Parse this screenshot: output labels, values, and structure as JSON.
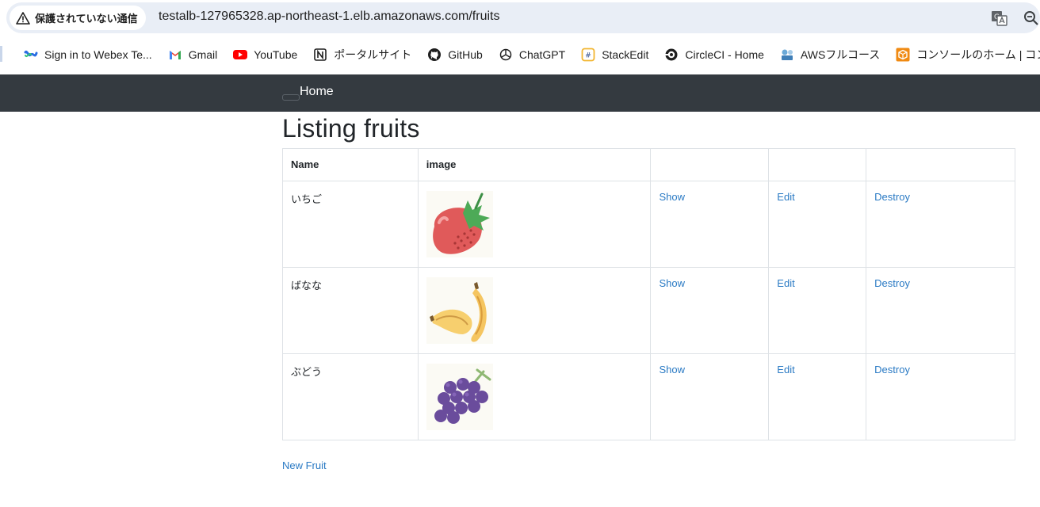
{
  "browser": {
    "security_label": "保護されていない通信",
    "url": "testalb-127965328.ap-northeast-1.elb.amazonaws.com/fruits"
  },
  "bookmarks": [
    {
      "label": "Sign in to Webex Te...",
      "icon": "webex-icon"
    },
    {
      "label": "Gmail",
      "icon": "gmail-icon"
    },
    {
      "label": "YouTube",
      "icon": "youtube-icon"
    },
    {
      "label": "ポータルサイト",
      "icon": "notion-icon"
    },
    {
      "label": "GitHub",
      "icon": "github-icon"
    },
    {
      "label": "ChatGPT",
      "icon": "chatgpt-icon"
    },
    {
      "label": "StackEdit",
      "icon": "stackedit-icon"
    },
    {
      "label": "CircleCI - Home",
      "icon": "circleci-icon"
    },
    {
      "label": "AWSフルコース",
      "icon": "aws-course-icon"
    },
    {
      "label": "コンソールのホーム | コン...",
      "icon": "aws-console-icon"
    }
  ],
  "navbar": {
    "home_label": "Home"
  },
  "page": {
    "title": "Listing fruits",
    "new_link": "New Fruit"
  },
  "table": {
    "headers": [
      "Name",
      "image",
      "",
      "",
      ""
    ],
    "rows": [
      {
        "name": "いちご",
        "image": "strawberry-image",
        "show": "Show",
        "edit": "Edit",
        "destroy": "Destroy"
      },
      {
        "name": "ばなな",
        "image": "banana-image",
        "show": "Show",
        "edit": "Edit",
        "destroy": "Destroy"
      },
      {
        "name": "ぶどう",
        "image": "grape-image",
        "show": "Show",
        "edit": "Edit",
        "destroy": "Destroy"
      }
    ]
  },
  "colors": {
    "navbar_bg": "#343a40",
    "link": "#2a7ac4",
    "table_border": "#dee2e6"
  }
}
